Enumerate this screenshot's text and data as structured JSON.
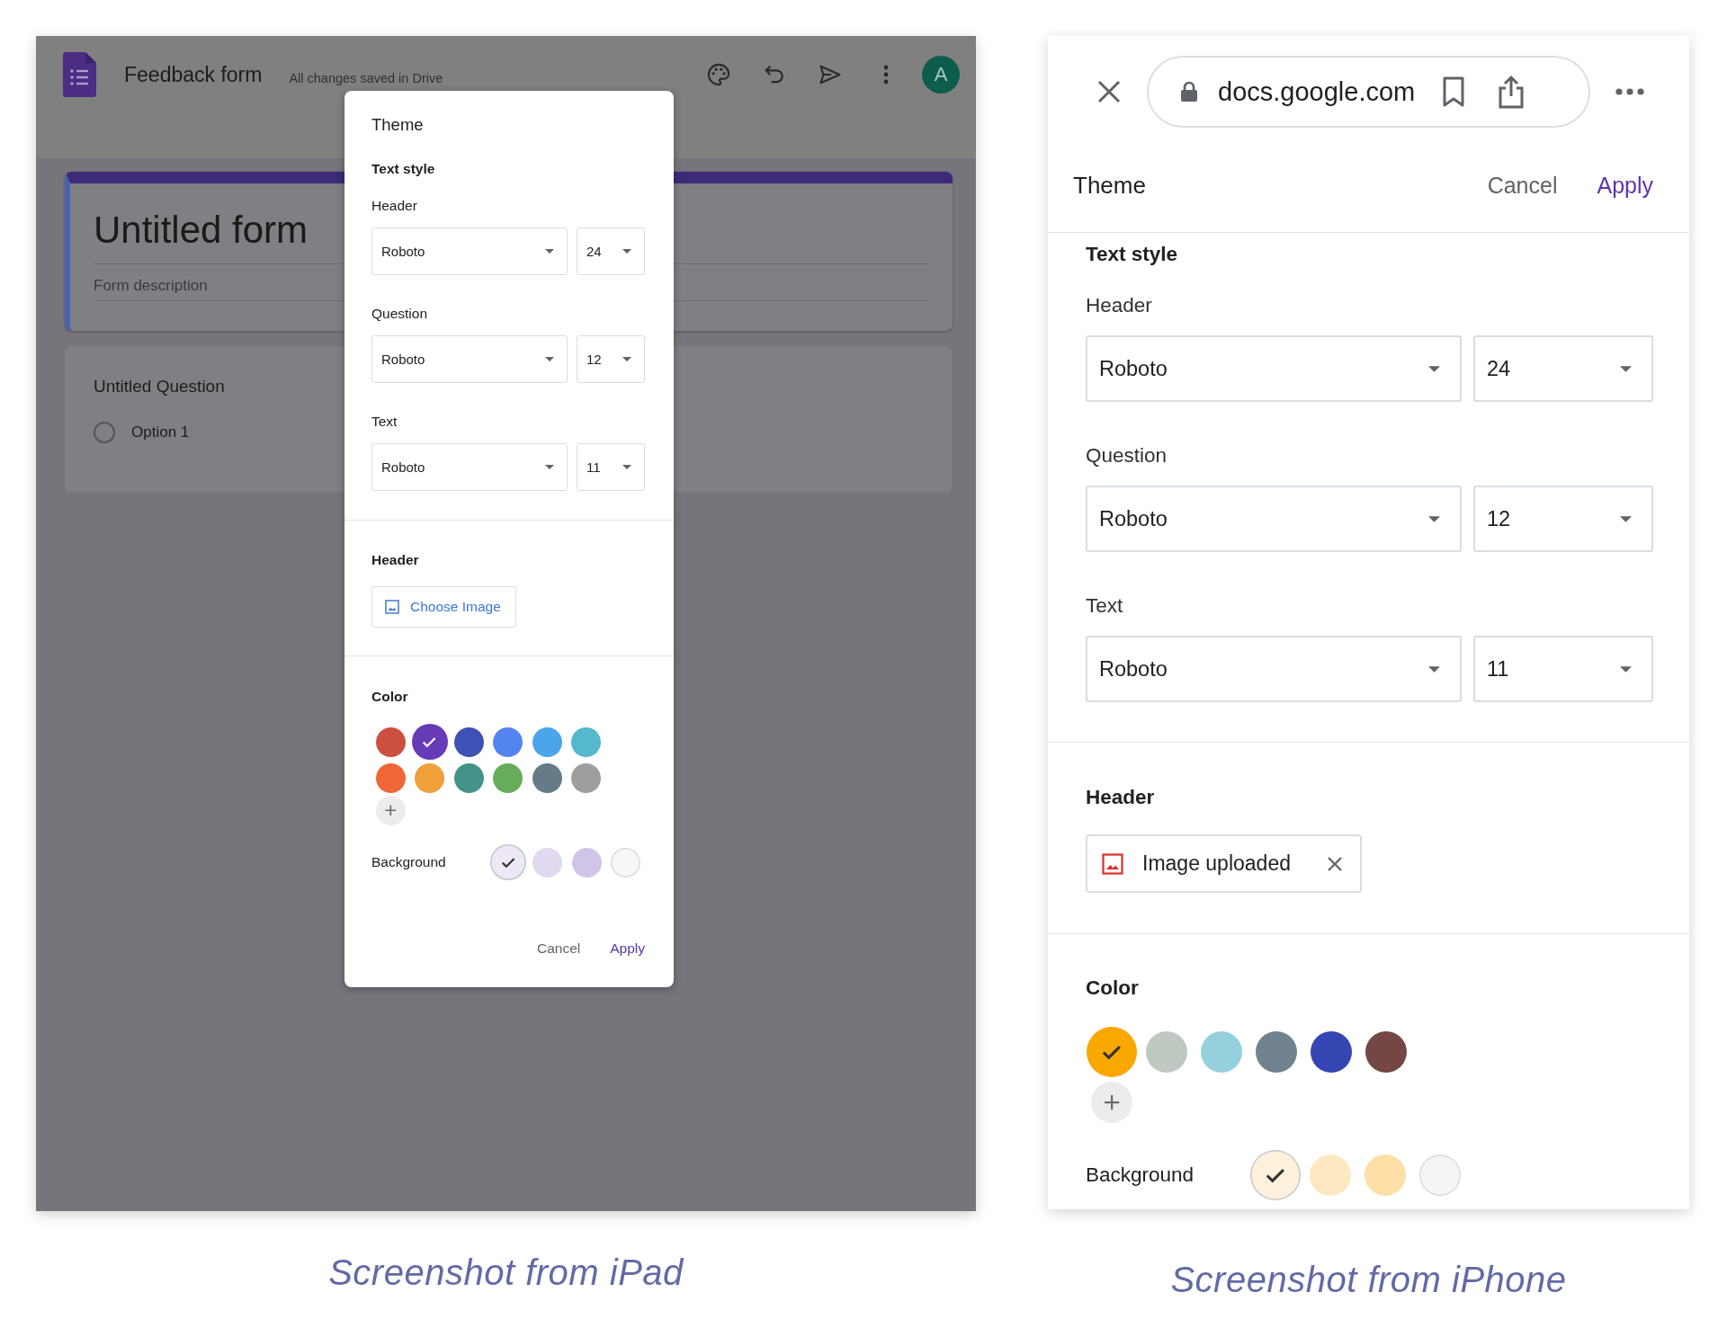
{
  "ipad_screenshot": {
    "app_bar": {
      "title": "Feedback form",
      "status": "All changes saved in Drive",
      "avatar": "A"
    },
    "form": {
      "title": "Untitled form",
      "description": {
        "placeholder": "Form description"
      },
      "question": {
        "title": "Untitled Question",
        "options": [
          {
            "label": "Option 1",
            "selected": false
          }
        ]
      }
    },
    "theme_dialog": {
      "title": "Theme",
      "text_style": {
        "label": "Text style",
        "fields": [
          {
            "label": "Header",
            "font": "Roboto",
            "size": "24"
          },
          {
            "label": "Question",
            "font": "Roboto",
            "size": "12"
          },
          {
            "label": "Text",
            "font": "Roboto",
            "size": "11"
          }
        ]
      },
      "header": {
        "label": "Header",
        "image": {
          "kind": "choose",
          "label": "Choose Image"
        }
      },
      "color": {
        "label": "Color",
        "swatches": [
          {
            "color": "#cb5040",
            "selected": false
          },
          {
            "color": "#673ab7",
            "selected": true
          },
          {
            "color": "#3f51b5",
            "selected": false
          },
          {
            "color": "#5484ed",
            "selected": false
          },
          {
            "color": "#4aa5ea",
            "selected": false
          },
          {
            "color": "#55b8cc",
            "selected": false
          },
          {
            "color": "#ef6637",
            "selected": false
          },
          {
            "color": "#f09f39",
            "selected": false
          },
          {
            "color": "#43938a",
            "selected": false
          },
          {
            "color": "#67ac5b",
            "selected": false
          },
          {
            "color": "#667a87",
            "selected": false
          },
          {
            "color": "#9e9e9e",
            "selected": false
          }
        ]
      },
      "background": {
        "label": "Background",
        "swatches": [
          {
            "color": "#ede7f6",
            "selected": true
          },
          {
            "color": "#e1d9ef",
            "selected": false
          },
          {
            "color": "#d1c4e9",
            "selected": false
          },
          {
            "color": "#f6f6f6",
            "selected": false
          }
        ]
      },
      "actions": [
        {
          "label": "Cancel",
          "kind": "secondary"
        },
        {
          "label": "Apply",
          "kind": "primary"
        }
      ]
    }
  },
  "iphone_screenshot": {
    "browser_bar": {
      "url": "docs.google.com"
    },
    "theme_sheet": {
      "title": "Theme",
      "actions": [
        {
          "label": "Cancel",
          "kind": "secondary"
        },
        {
          "label": "Apply",
          "kind": "primary"
        }
      ],
      "text_style": {
        "label": "Text style",
        "fields": [
          {
            "label": "Header",
            "font": "Roboto",
            "size": "24"
          },
          {
            "label": "Question",
            "font": "Roboto",
            "size": "12"
          },
          {
            "label": "Text",
            "font": "Roboto",
            "size": "11"
          }
        ]
      },
      "header": {
        "label": "Header",
        "image": {
          "kind": "uploaded",
          "label": "Image uploaded"
        }
      },
      "color": {
        "label": "Color",
        "swatches": [
          {
            "color": "#f9a800",
            "selected": true
          },
          {
            "color": "#bfc9c2",
            "selected": false
          },
          {
            "color": "#95d1dc",
            "selected": false
          },
          {
            "color": "#6f828e",
            "selected": false
          },
          {
            "color": "#3546b3",
            "selected": false
          },
          {
            "color": "#744644",
            "selected": false
          }
        ]
      },
      "background": {
        "label": "Background",
        "swatches": [
          {
            "color": "#fdf1dc",
            "selected": true
          },
          {
            "color": "#fde8c2",
            "selected": false
          },
          {
            "color": "#fddfa7",
            "selected": false
          },
          {
            "color": "#f5f5f5",
            "selected": false
          }
        ]
      }
    }
  },
  "captions": [
    "Screenshot from iPad",
    "Screenshot from iPhone"
  ]
}
